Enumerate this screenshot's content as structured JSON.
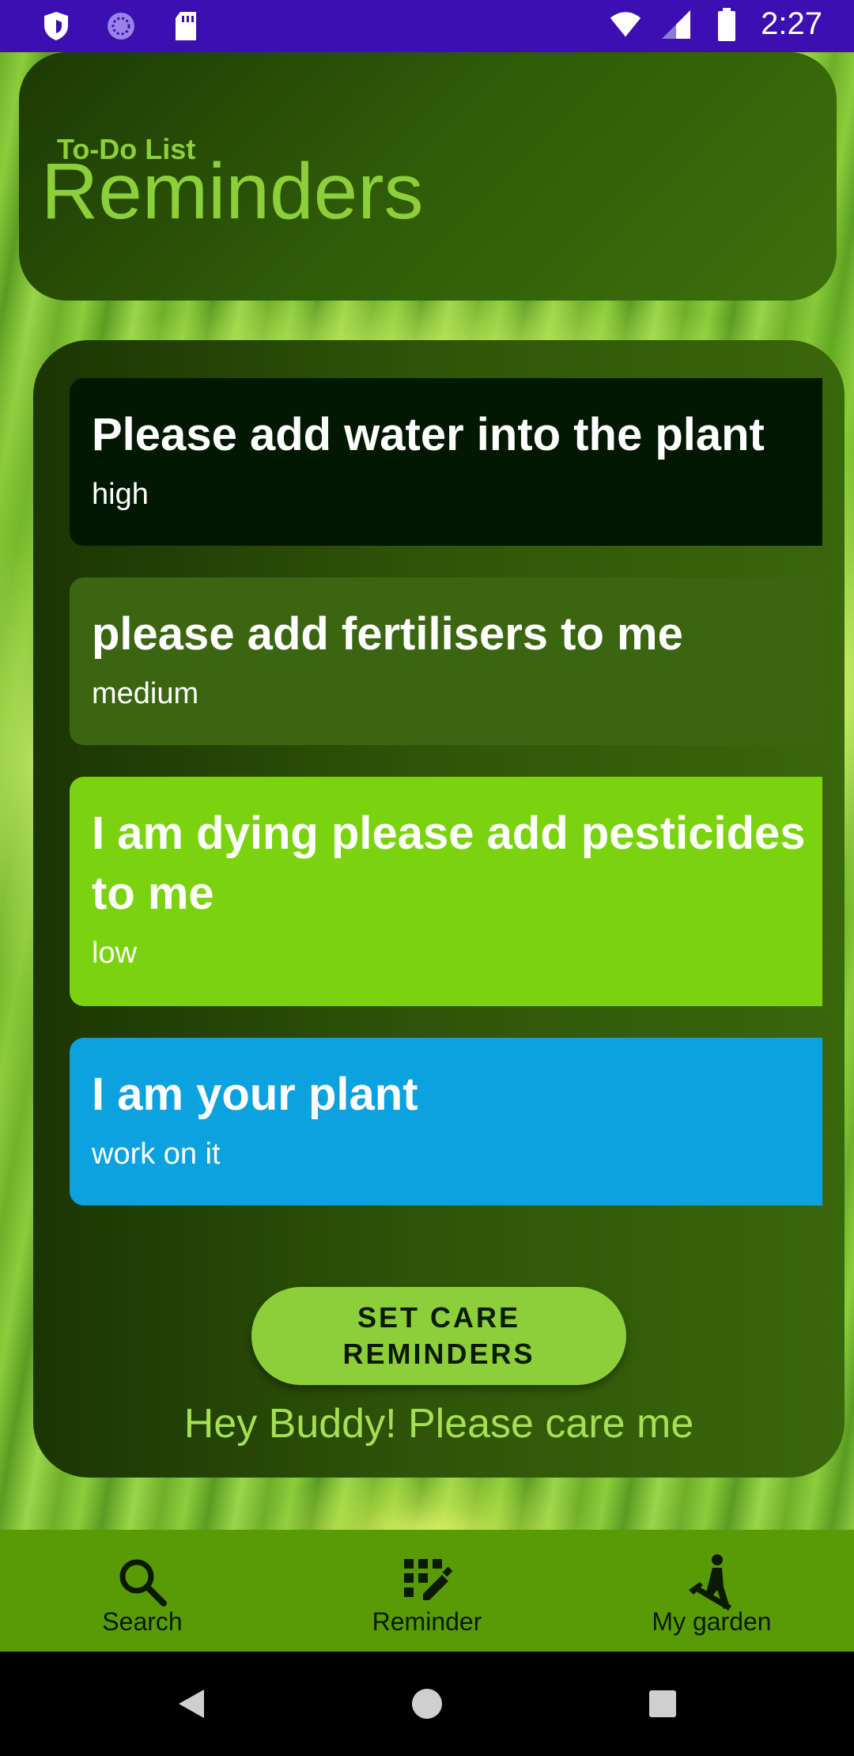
{
  "status_bar": {
    "time": "2:27",
    "icons": [
      "shield-icon",
      "spinner-icon",
      "sd-card-icon",
      "wifi-icon",
      "signal-icon",
      "battery-icon"
    ]
  },
  "header": {
    "subtitle": "To-Do List",
    "title": "Reminders"
  },
  "reminders": [
    {
      "title": "Please add water into the plant",
      "level": "high",
      "color": "#031803"
    },
    {
      "title": "please add fertilisers to me",
      "level": "medium",
      "color": "#3c6512"
    },
    {
      "title": "I am dying please add pesticides to me",
      "level": "low",
      "color": "#7bd20e"
    },
    {
      "title": "I am your plant",
      "level": "work on it",
      "color": "#0ba2df"
    }
  ],
  "care_button_label": "SET CARE REMINDERS",
  "footer_text": "Hey Buddy! Please care me",
  "bottom_nav": {
    "items": [
      {
        "label": "Search",
        "icon": "search-icon"
      },
      {
        "label": "Reminder",
        "icon": "edit-calendar-icon"
      },
      {
        "label": "My garden",
        "icon": "gardener-icon"
      }
    ]
  },
  "system_nav": [
    "back-icon",
    "home-icon",
    "recents-icon"
  ],
  "colors": {
    "status_bar": "#3b0fb0",
    "accent_green": "#8ccf3a",
    "bottom_nav": "#589b07"
  }
}
